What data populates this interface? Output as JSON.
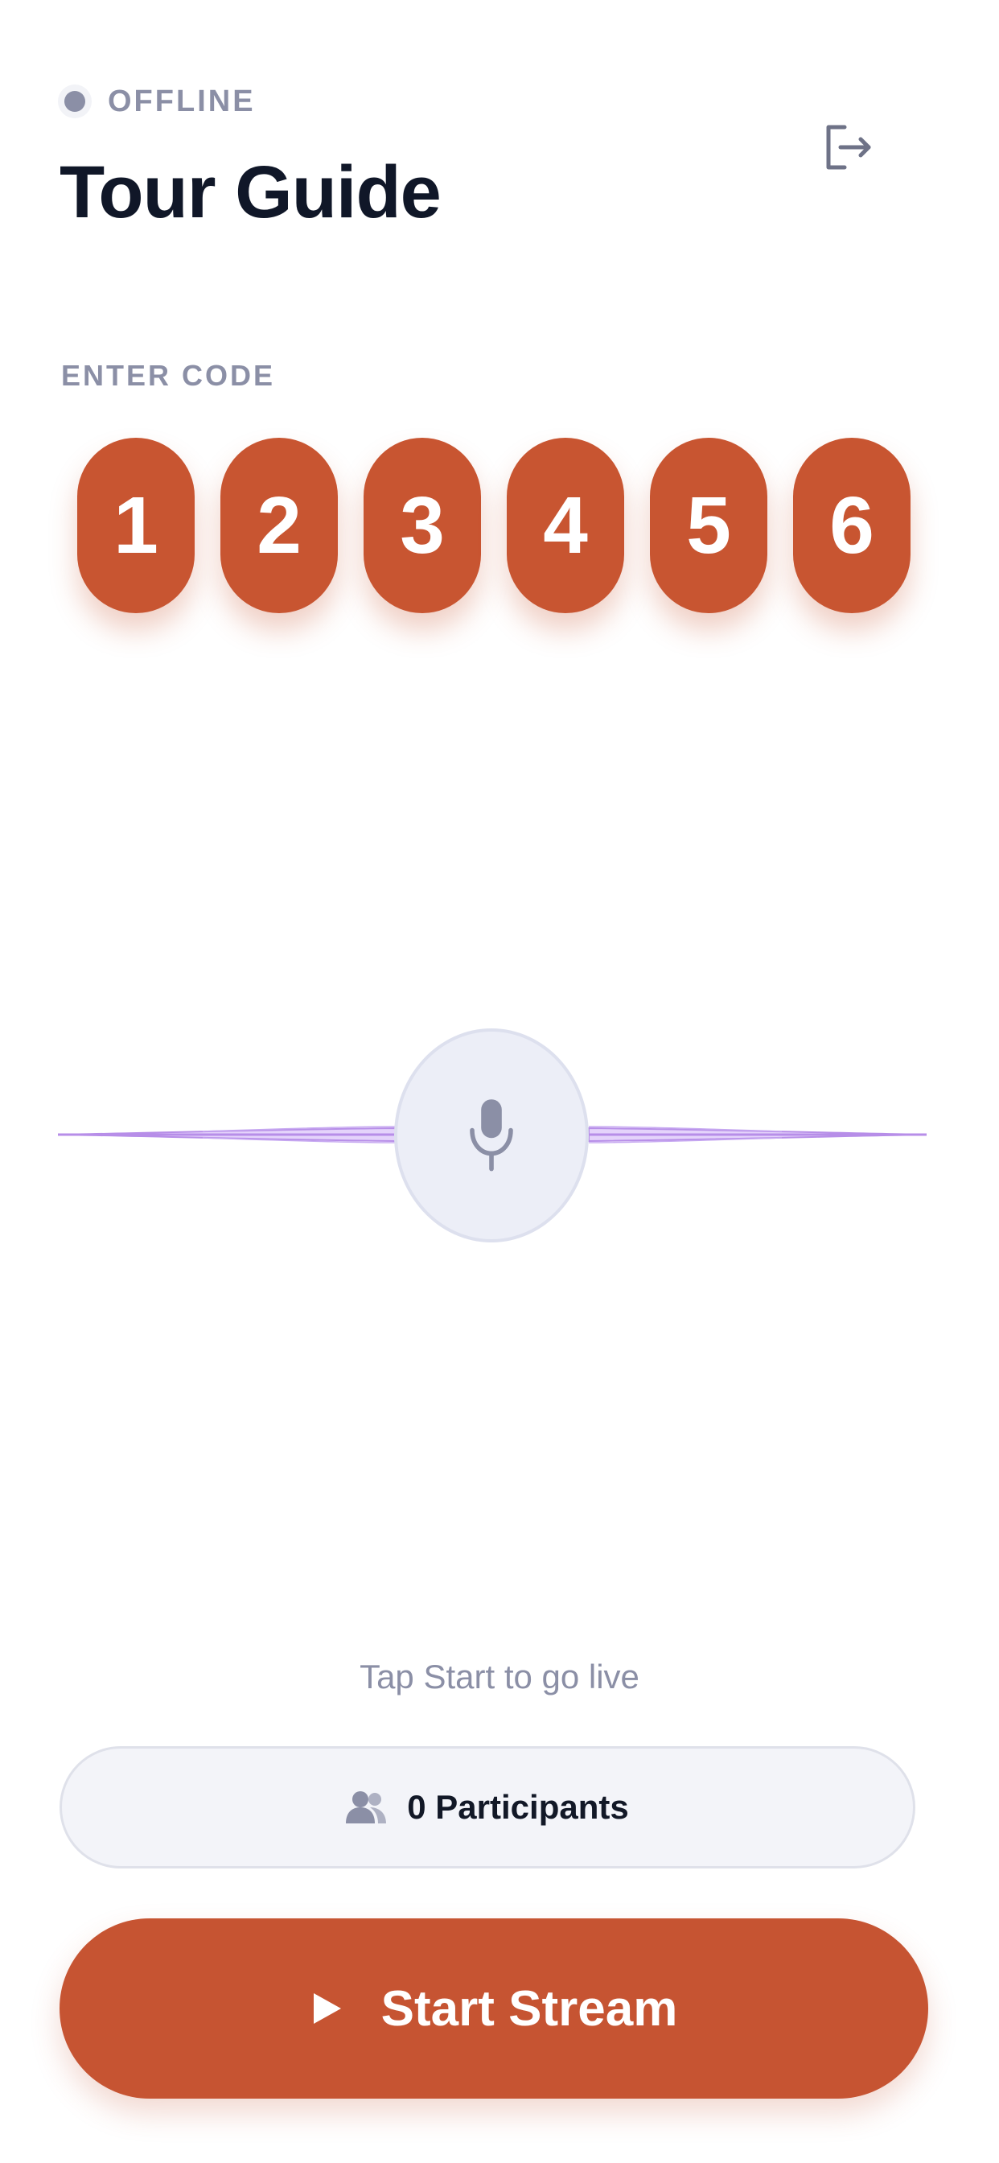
{
  "header": {
    "status_text": "OFFLINE",
    "title": "Tour Guide",
    "logout_icon": "logout-icon"
  },
  "code": {
    "label": "ENTER CODE",
    "digits": [
      "1",
      "2",
      "3",
      "4",
      "5",
      "6"
    ]
  },
  "audio": {
    "mic_icon": "microphone-icon"
  },
  "footer": {
    "hint": "Tap Start to go live",
    "participants_label": "0 Participants",
    "participants_icon": "users-icon",
    "start_label": "Start Stream",
    "start_icon": "play-icon"
  },
  "colors": {
    "accent": "#c85531",
    "muted": "#8b8fa6",
    "text": "#101728",
    "wave": "#b78ee8"
  }
}
